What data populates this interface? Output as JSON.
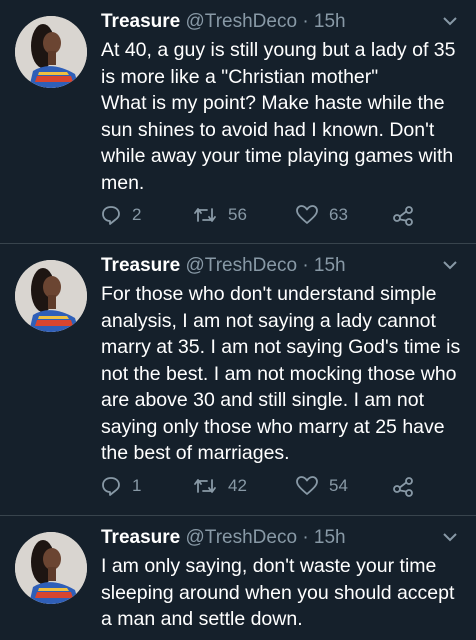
{
  "tweets": [
    {
      "name": "Treasure",
      "handle": "@TreshDeco",
      "separator": "·",
      "time": "15h",
      "text": "At 40, a guy is still young but a lady of 35 is more like a \"Christian mother\"\nWhat is my point? Make haste while the sun shines to avoid had I known. Don't while away your time playing games with men.",
      "replies": "2",
      "retweets": "56",
      "likes": "63"
    },
    {
      "name": "Treasure",
      "handle": "@TreshDeco",
      "separator": "·",
      "time": "15h",
      "text": "For those who don't understand simple analysis, I am not saying a lady cannot marry at 35. I am not saying God's time is not the best. I am not mocking those who are above 30 and still single. I am not saying only those who marry at 25 have the best of marriages.",
      "replies": "1",
      "retweets": "42",
      "likes": "54"
    },
    {
      "name": "Treasure",
      "handle": "@TreshDeco",
      "separator": "·",
      "time": "15h",
      "text": "I am only saying, don't waste your time sleeping around when you should accept a man and settle down."
    }
  ],
  "icons": {
    "reply": "reply-icon",
    "retweet": "retweet-icon",
    "like": "heart-icon",
    "share": "share-icon",
    "caret": "chevron-down-icon"
  },
  "colors": {
    "background": "#15202b",
    "divider": "#38444d",
    "text": "#ffffff",
    "secondary": "#8899a6"
  }
}
